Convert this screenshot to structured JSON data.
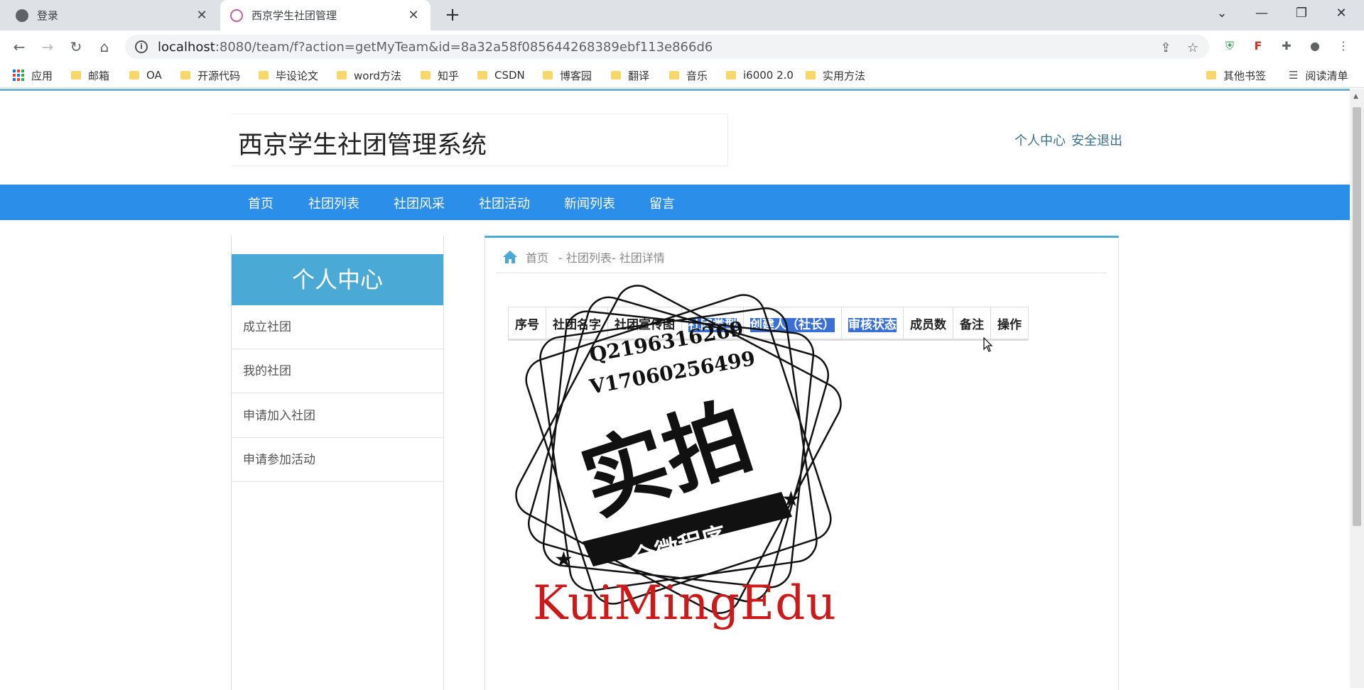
{
  "browser": {
    "tabs": [
      {
        "title": "登录",
        "active": false
      },
      {
        "title": "西京学生社团管理",
        "active": true
      }
    ],
    "url_host": "localhost",
    "url_path": ":8080/team/f?action=getMyTeam&id=8a32a58f085644268389ebf113e866d6",
    "bookmarks": [
      "应用",
      "邮箱",
      "OA",
      "开源代码",
      "毕设论文",
      "word方法",
      "知乎",
      "CSDN",
      "博客园",
      "翻译",
      "音乐",
      "i6000 2.0",
      "实用方法"
    ],
    "other_bookmarks": "其他书签",
    "reading_list": "阅读清单"
  },
  "site": {
    "title": "西京学生社团管理系统",
    "personal_center": "个人中心",
    "logout": "安全退出",
    "nav": [
      "首页",
      "社团列表",
      "社团风采",
      "社团活动",
      "新闻列表",
      "留言"
    ]
  },
  "sidebar": {
    "heading": "个人中心",
    "items": [
      "成立社团",
      "我的社团",
      "申请加入社团",
      "申请参加活动"
    ]
  },
  "breadcrumb": {
    "home": "首页",
    "trail": "- 社团列表- 社团详情"
  },
  "table": {
    "headers": [
      "序号",
      "社团名字",
      "社团宣传图",
      "社团类型",
      "创建人（社长）",
      "审核状态",
      "成员数",
      "备注",
      "操作"
    ]
  },
  "watermark": {
    "qq": "Q2196316269",
    "wx": "V17060256499",
    "big": "实拍",
    "banner": "全微程序",
    "brand": "KuiMingEdu"
  },
  "colors": {
    "nav_bg": "#2b8ee9",
    "side_head_bg": "#4aaad5",
    "selection": "#3a6fd8",
    "brand_red": "#cc1a1a"
  }
}
